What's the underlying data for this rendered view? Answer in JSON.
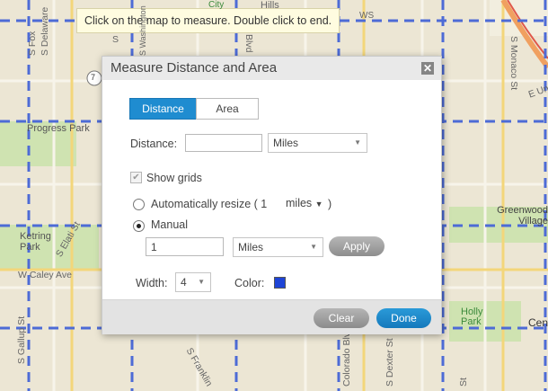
{
  "map": {
    "tooltip": "Click on the map to measure.  Double click to end.",
    "labels": {
      "delaware": "S Delaware",
      "fox": "S Fox",
      "monaco": "S Monaco St",
      "e_un": "E Un",
      "progress_park": "Progress Park",
      "greenwood_village": "Greenwood Village",
      "ketring_park": "Ketring Park",
      "elati": "S Elati St",
      "w_caley": "W Caley Ave",
      "gallup": "S Gallup St",
      "franklin": "S Franklin",
      "colorado_blvd": "Colorado Blvd",
      "dexter": "S Dexter St",
      "holly_park": "Holly Park",
      "cen": "Cen",
      "top_city": "City",
      "top_hills": "Hills",
      "shield": "7",
      "washington": "S Washington",
      "blvd": "Blvd",
      "st_end": "St",
      "s": "S",
      "ws": "WS"
    }
  },
  "dialog": {
    "title": "Measure Distance and Area",
    "close_label": "✕",
    "tabs": {
      "distance": "Distance",
      "area": "Area"
    },
    "distance_label": "Distance:",
    "distance_value": "",
    "distance_unit": "Miles",
    "show_grids": "Show grids",
    "auto_resize": {
      "label": "Automatically resize ( 1",
      "unit": "miles",
      "close": ")"
    },
    "manual": {
      "label": "Manual",
      "value": "1",
      "unit": "Miles",
      "apply": "Apply"
    },
    "width": {
      "label": "Width:",
      "value": "4"
    },
    "color": {
      "label": "Color:",
      "value": "#1e44d6"
    },
    "buttons": {
      "clear": "Clear",
      "done": "Done"
    }
  }
}
